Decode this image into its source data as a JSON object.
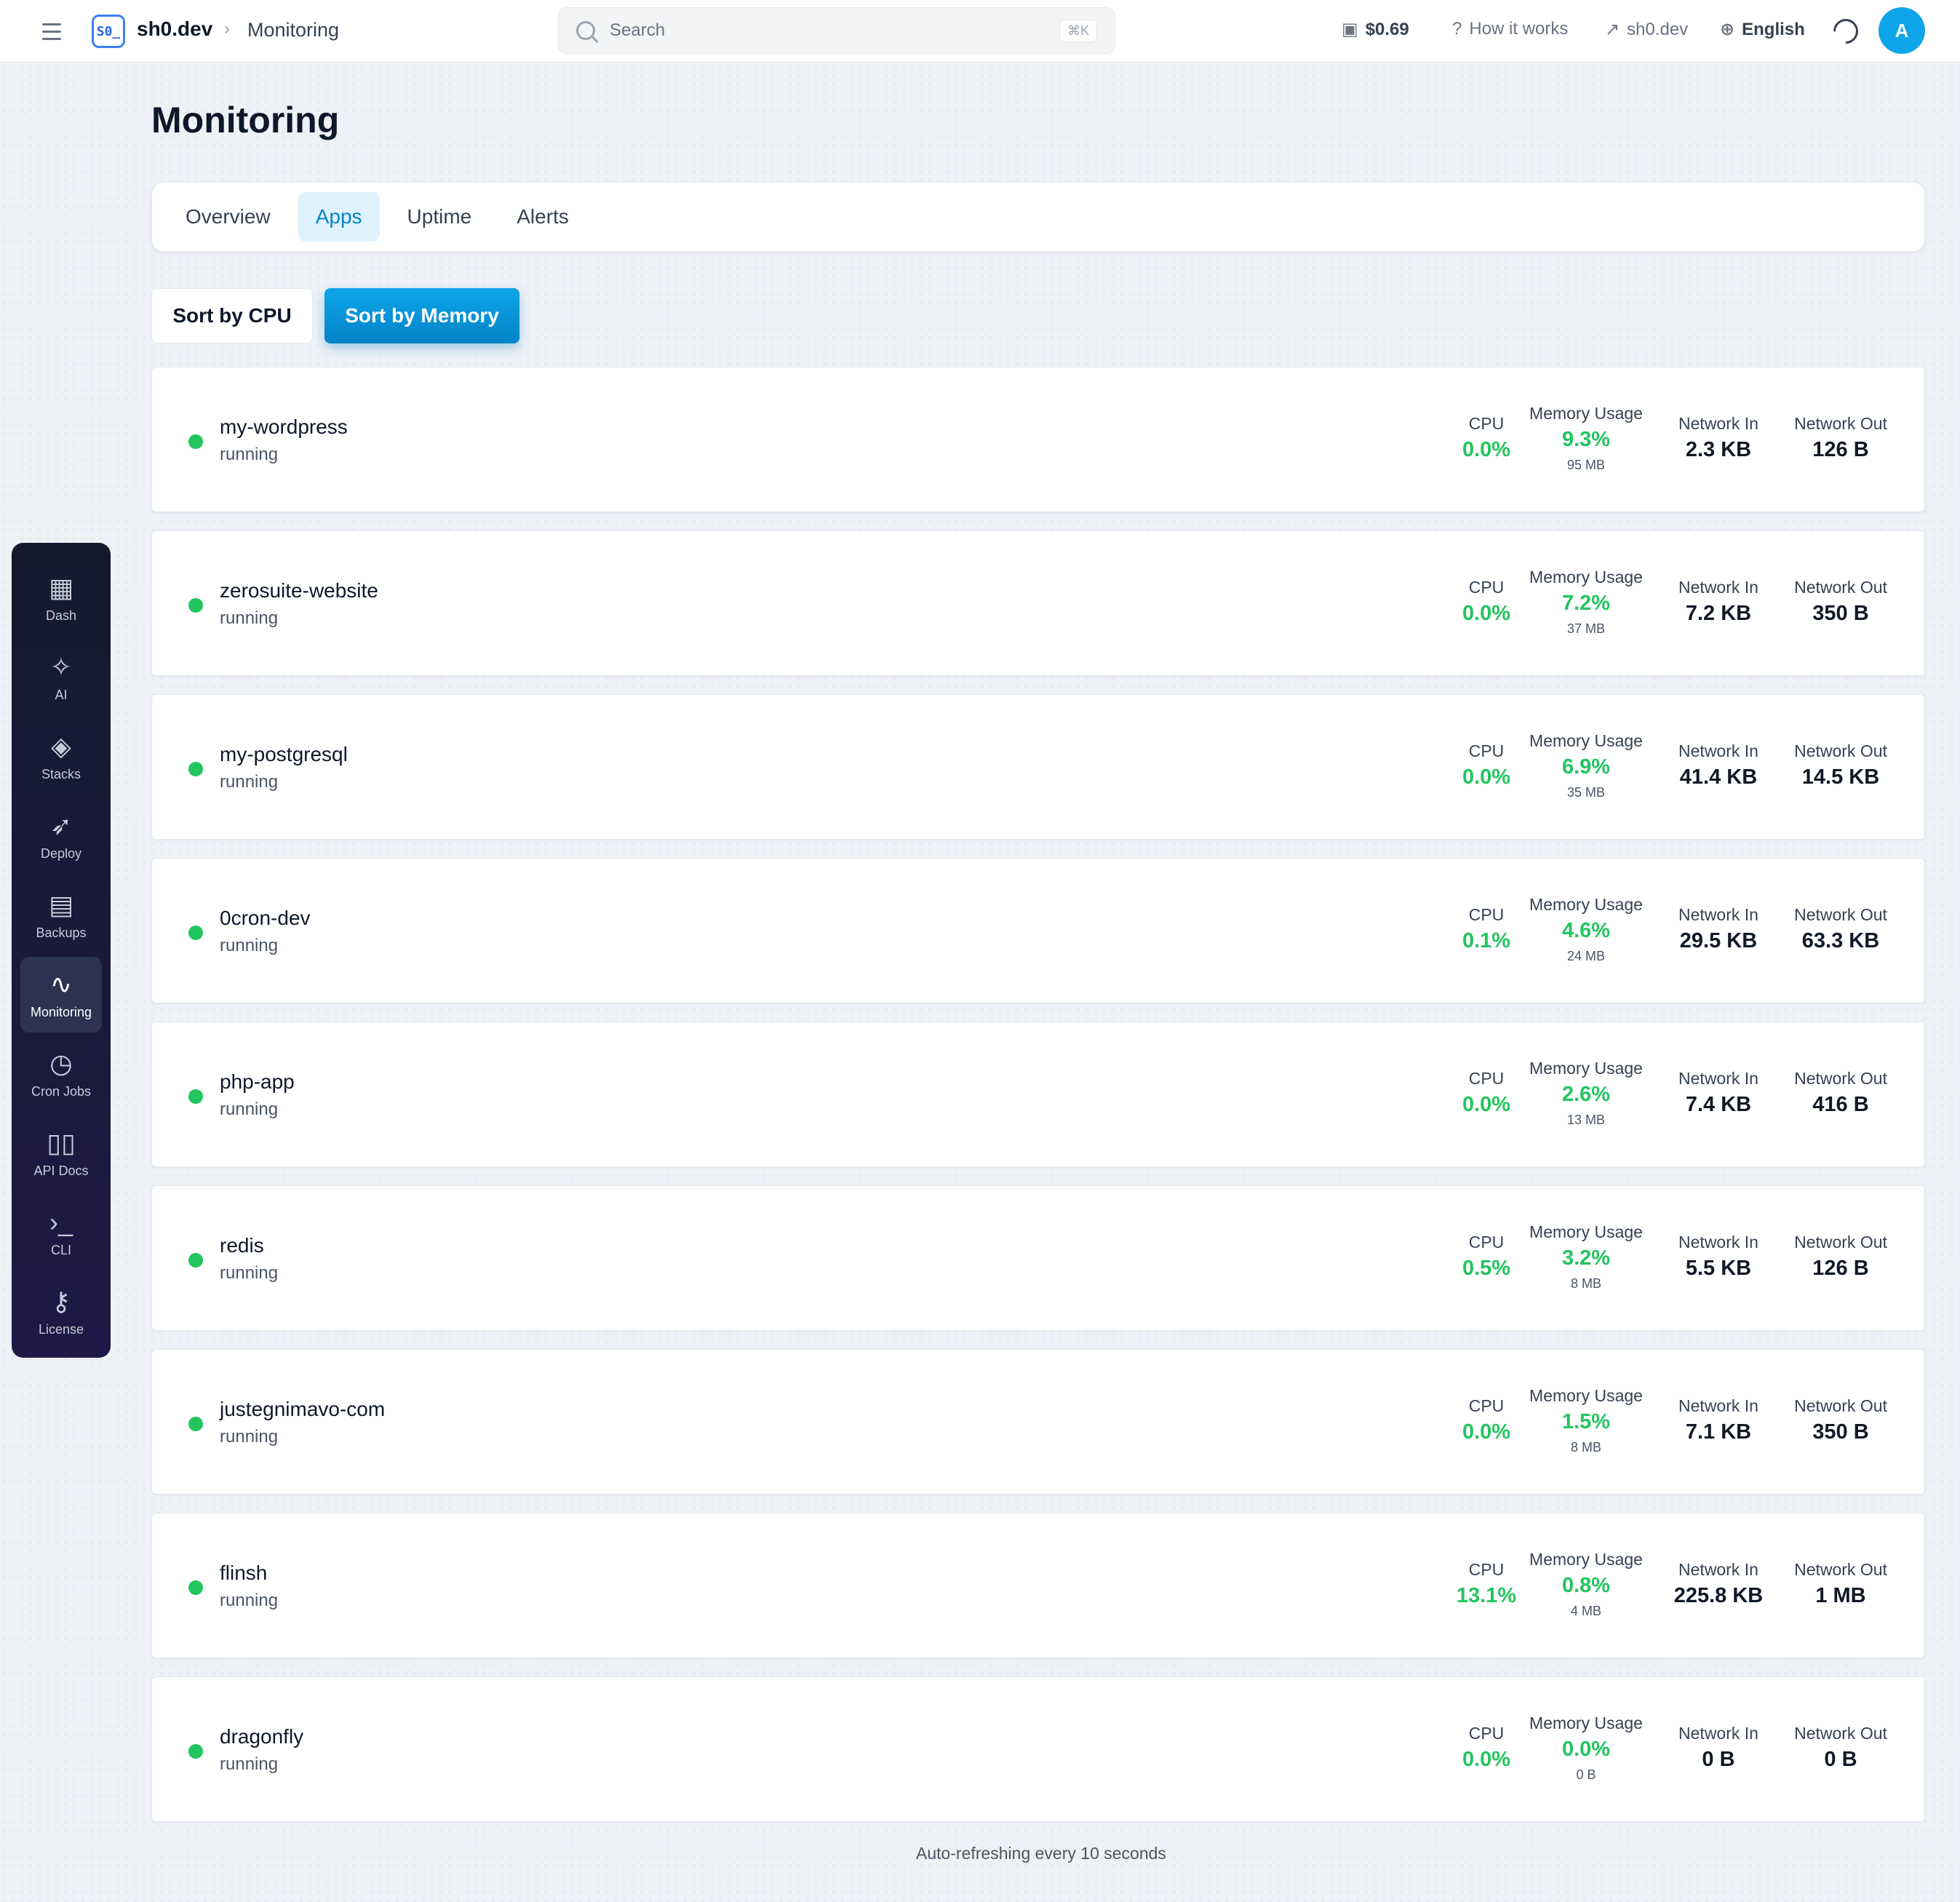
{
  "topbar": {
    "logo_text": "S0_",
    "brand": "sh0.dev",
    "crumb": "Monitoring",
    "search_placeholder": "Search",
    "search_shortcut": "⌘K",
    "balance": "$0.69",
    "how_it_works": "How it works",
    "external_link": "sh0.dev",
    "language": "English",
    "avatar_initial": "A"
  },
  "sidebar": {
    "items": [
      {
        "label": "Dash",
        "icon": "grid-icon",
        "glyph": "▦"
      },
      {
        "label": "AI",
        "icon": "sparkles-icon",
        "glyph": "✧"
      },
      {
        "label": "Stacks",
        "icon": "layers-icon",
        "glyph": "◈"
      },
      {
        "label": "Deploy",
        "icon": "rocket-icon",
        "glyph": "➶"
      },
      {
        "label": "Backups",
        "icon": "archive-icon",
        "glyph": "▤"
      },
      {
        "label": "Monitoring",
        "icon": "activity-icon",
        "glyph": "∿"
      },
      {
        "label": "Cron Jobs",
        "icon": "clock-icon",
        "glyph": "◷"
      },
      {
        "label": "API Docs",
        "icon": "book-icon",
        "glyph": "▯▯"
      },
      {
        "label": "CLI",
        "icon": "terminal-icon",
        "glyph": "›_"
      },
      {
        "label": "License",
        "icon": "key-icon",
        "glyph": "⚷"
      }
    ],
    "active_index": 5
  },
  "page": {
    "title": "Monitoring",
    "tabs": [
      "Overview",
      "Apps",
      "Uptime",
      "Alerts"
    ],
    "active_tab": "Apps",
    "sort_cpu": "Sort by CPU",
    "sort_memory": "Sort by Memory",
    "footer": "Auto-refreshing every 10 seconds"
  },
  "labels": {
    "cpu": "CPU",
    "memory": "Memory Usage",
    "net_in": "Network In",
    "net_out": "Network Out"
  },
  "colors": {
    "accent": "#0284c7",
    "status_running": "#22c55e"
  },
  "apps": [
    {
      "name": "my-wordpress",
      "status": "running",
      "cpu": "0.0%",
      "mem_pct": "9.3%",
      "mem_abs": "95 MB",
      "net_in": "2.3 KB",
      "net_out": "126 B"
    },
    {
      "name": "zerosuite-website",
      "status": "running",
      "cpu": "0.0%",
      "mem_pct": "7.2%",
      "mem_abs": "37 MB",
      "net_in": "7.2 KB",
      "net_out": "350 B"
    },
    {
      "name": "my-postgresql",
      "status": "running",
      "cpu": "0.0%",
      "mem_pct": "6.9%",
      "mem_abs": "35 MB",
      "net_in": "41.4 KB",
      "net_out": "14.5 KB"
    },
    {
      "name": "0cron-dev",
      "status": "running",
      "cpu": "0.1%",
      "mem_pct": "4.6%",
      "mem_abs": "24 MB",
      "net_in": "29.5 KB",
      "net_out": "63.3 KB"
    },
    {
      "name": "php-app",
      "status": "running",
      "cpu": "0.0%",
      "mem_pct": "2.6%",
      "mem_abs": "13 MB",
      "net_in": "7.4 KB",
      "net_out": "416 B"
    },
    {
      "name": "redis",
      "status": "running",
      "cpu": "0.5%",
      "mem_pct": "3.2%",
      "mem_abs": "8 MB",
      "net_in": "5.5 KB",
      "net_out": "126 B"
    },
    {
      "name": "justegnimavo-com",
      "status": "running",
      "cpu": "0.0%",
      "mem_pct": "1.5%",
      "mem_abs": "8 MB",
      "net_in": "7.1 KB",
      "net_out": "350 B"
    },
    {
      "name": "flinsh",
      "status": "running",
      "cpu": "13.1%",
      "mem_pct": "0.8%",
      "mem_abs": "4 MB",
      "net_in": "225.8 KB",
      "net_out": "1 MB"
    },
    {
      "name": "dragonfly",
      "status": "running",
      "cpu": "0.0%",
      "mem_pct": "0.0%",
      "mem_abs": "0 B",
      "net_in": "0 B",
      "net_out": "0 B"
    }
  ]
}
